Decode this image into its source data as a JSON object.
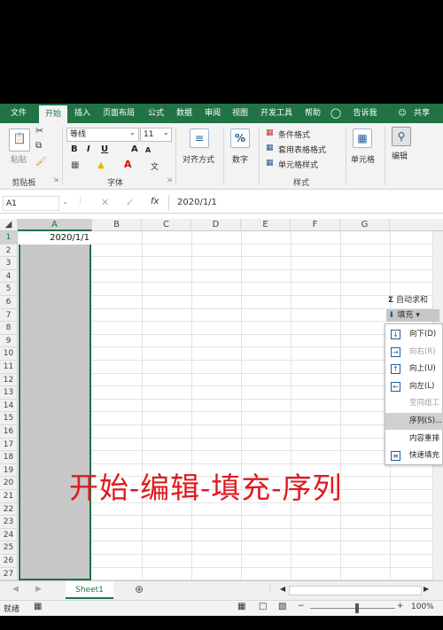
{
  "tabs": [
    "文件",
    "开始",
    "插入",
    "页面布局",
    "公式",
    "数据",
    "审阅",
    "视图",
    "开发工具",
    "帮助",
    "告诉我",
    "共享"
  ],
  "ribbon": {
    "clipboard": {
      "paste": "粘贴",
      "label": "剪贴板"
    },
    "font": {
      "name": "等线",
      "size": "11",
      "label": "字体",
      "bold": "B",
      "italic": "I",
      "underline": "U",
      "grow": "A",
      "shrink": "A"
    },
    "alignment": {
      "label": "对齐方式"
    },
    "number": {
      "label": "数字",
      "symbol": "%"
    },
    "styles": {
      "conditional": "条件格式",
      "table": "套用表格格式",
      "cell": "单元格样式",
      "label": "样式"
    },
    "cells": {
      "label": "单元格"
    },
    "editing": {
      "label": "编辑"
    },
    "autosum": "自动求和",
    "fill": "填充"
  },
  "formula_bar": {
    "name_box": "A1",
    "fx": "fx",
    "value": "2020/1/1"
  },
  "columns": [
    "A",
    "B",
    "C",
    "D",
    "E",
    "F",
    "G"
  ],
  "rows": [
    "1",
    "2",
    "3",
    "4",
    "5",
    "6",
    "7",
    "8",
    "9",
    "10",
    "11",
    "12",
    "13",
    "14",
    "15",
    "16",
    "17",
    "18",
    "19",
    "20",
    "21",
    "22",
    "23",
    "24",
    "25",
    "26",
    "27"
  ],
  "cells": {
    "A1": "2020/1/1"
  },
  "fill_menu": [
    {
      "label": "向下(D)",
      "enabled": true,
      "highlight": false,
      "icon": "arrow-down-icon"
    },
    {
      "label": "向右(R)",
      "enabled": false,
      "highlight": false,
      "icon": "arrow-right-icon"
    },
    {
      "label": "向上(U)",
      "enabled": true,
      "highlight": false,
      "icon": "arrow-up-icon"
    },
    {
      "label": "向左(L)",
      "enabled": true,
      "highlight": false,
      "icon": "arrow-left-icon"
    },
    {
      "label": "至同组工",
      "enabled": false,
      "highlight": false,
      "icon": ""
    },
    {
      "label": "序列(S)...",
      "enabled": true,
      "highlight": true,
      "icon": ""
    },
    {
      "label": "内容重排",
      "enabled": true,
      "highlight": false,
      "icon": ""
    },
    {
      "label": "快速填充",
      "enabled": true,
      "highlight": false,
      "icon": "flash-fill-icon"
    }
  ],
  "caption": "开始-编辑-填充-序列",
  "sheet_tab": "Sheet1",
  "status": {
    "ready": "就绪",
    "zoom": "100%"
  },
  "colors": {
    "accent": "#217346",
    "caption": "#e0191d"
  }
}
